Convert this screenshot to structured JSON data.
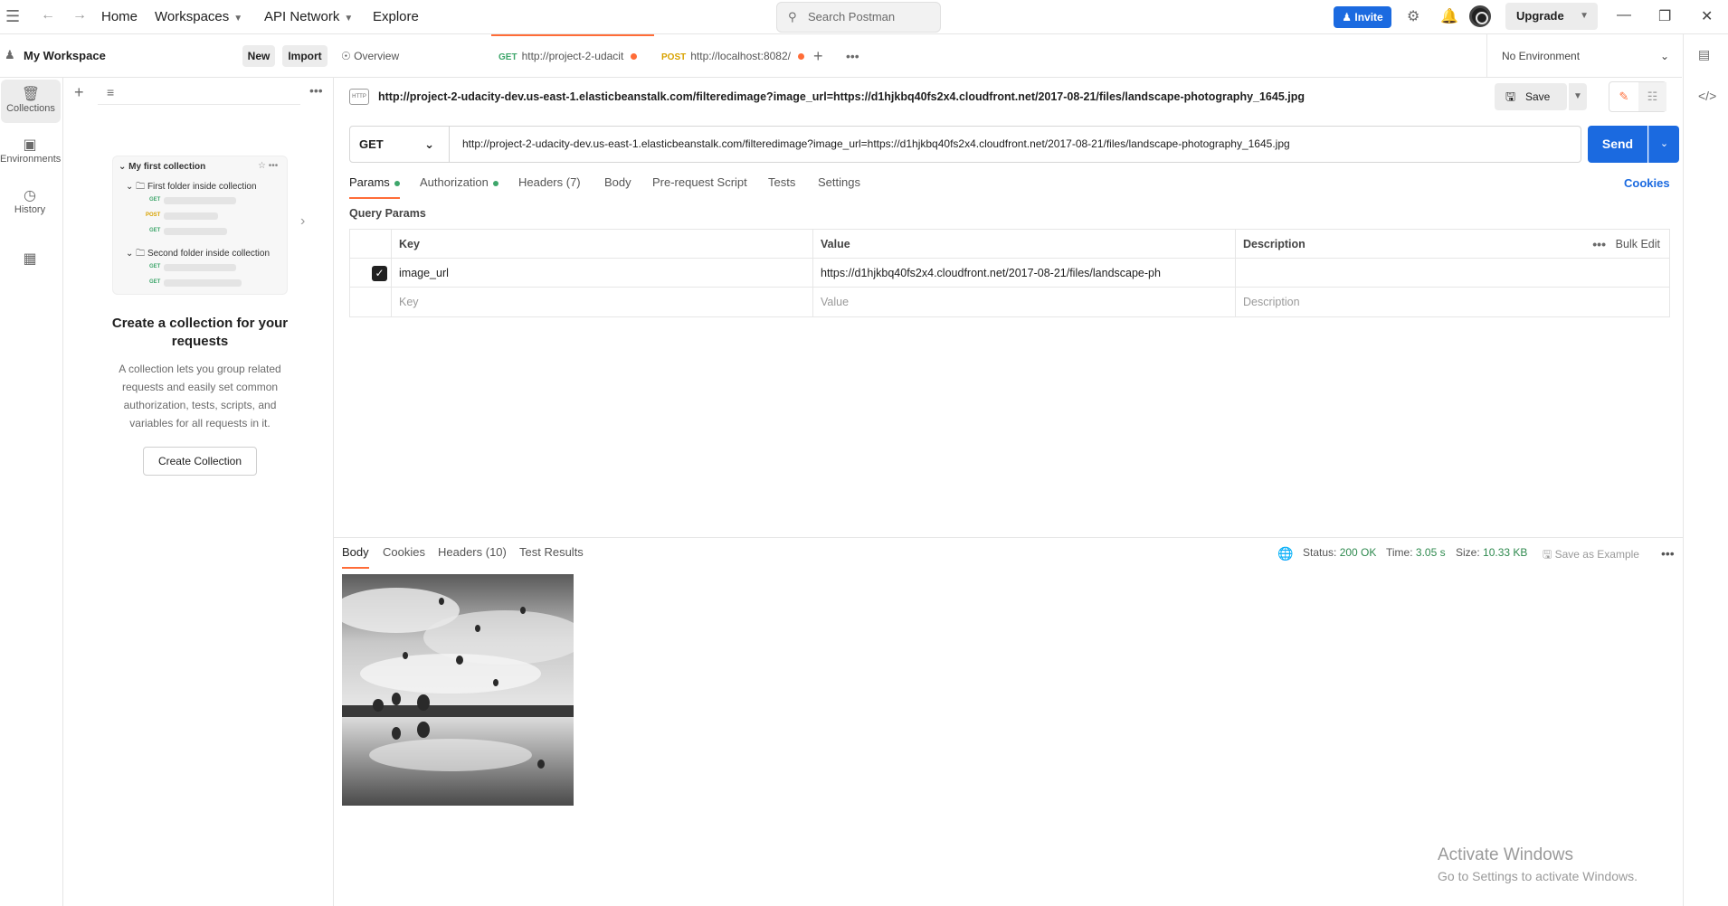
{
  "topbar": {
    "menu": [
      "Home",
      "Workspaces",
      "API Network",
      "Explore"
    ],
    "search_placeholder": "Search Postman",
    "invite": "Invite",
    "upgrade": "Upgrade"
  },
  "workspace": {
    "title": "My Workspace",
    "new": "New",
    "import": "Import"
  },
  "rail": [
    "Collections",
    "Environments",
    "History"
  ],
  "collection_preview": {
    "name": "My first collection",
    "folder1": "First folder inside collection",
    "folder2": "Second folder inside collection",
    "methods": [
      "GET",
      "POST",
      "GET",
      "GET",
      "GET"
    ]
  },
  "empty_state": {
    "title": "Create a collection for your requests",
    "description": "A collection lets you group related requests and easily set common authorization, tests, scripts, and variables for all requests in it.",
    "button": "Create Collection"
  },
  "tabs": [
    {
      "method": "",
      "label": "Overview"
    },
    {
      "method": "GET",
      "label": "http://project-2-udacit"
    },
    {
      "method": "POST",
      "label": "http://localhost:8082/"
    }
  ],
  "environment": "No Environment",
  "request": {
    "header_url": "http://project-2-udacity-dev.us-east-1.elasticbeanstalk.com/filteredimage?image_url=https://d1hjkbq40fs2x4.cloudfront.net/2017-08-21/files/landscape-photography_1645.jpg",
    "method": "GET",
    "url": "http://project-2-udacity-dev.us-east-1.elasticbeanstalk.com/filteredimage?image_url=https://d1hjkbq40fs2x4.cloudfront.net/2017-08-21/files/landscape-photography_1645.jpg",
    "save": "Save",
    "send": "Send",
    "http_icon": "HTTP"
  },
  "request_tabs": [
    "Params",
    "Authorization",
    "Headers (7)",
    "Body",
    "Pre-request Script",
    "Tests",
    "Settings"
  ],
  "cookies": "Cookies",
  "query_params": {
    "label": "Query Params",
    "headers": [
      "Key",
      "Value",
      "Description"
    ],
    "bulk_edit": "Bulk Edit",
    "rows": [
      {
        "key": "image_url",
        "value": "https://d1hjkbq40fs2x4.cloudfront.net/2017-08-21/files/landscape-ph",
        "description": ""
      }
    ],
    "placeholders": {
      "key": "Key",
      "value": "Value",
      "description": "Description"
    }
  },
  "response": {
    "tabs": [
      "Body",
      "Cookies",
      "Headers (10)",
      "Test Results"
    ],
    "status_label": "Status:",
    "status": "200 OK",
    "time_label": "Time:",
    "time": "3.05 s",
    "size_label": "Size:",
    "size": "10.33 KB",
    "save_example": "Save as Example"
  },
  "watermark": {
    "line1": "Activate Windows",
    "line2": "Go to Settings to activate Windows."
  }
}
